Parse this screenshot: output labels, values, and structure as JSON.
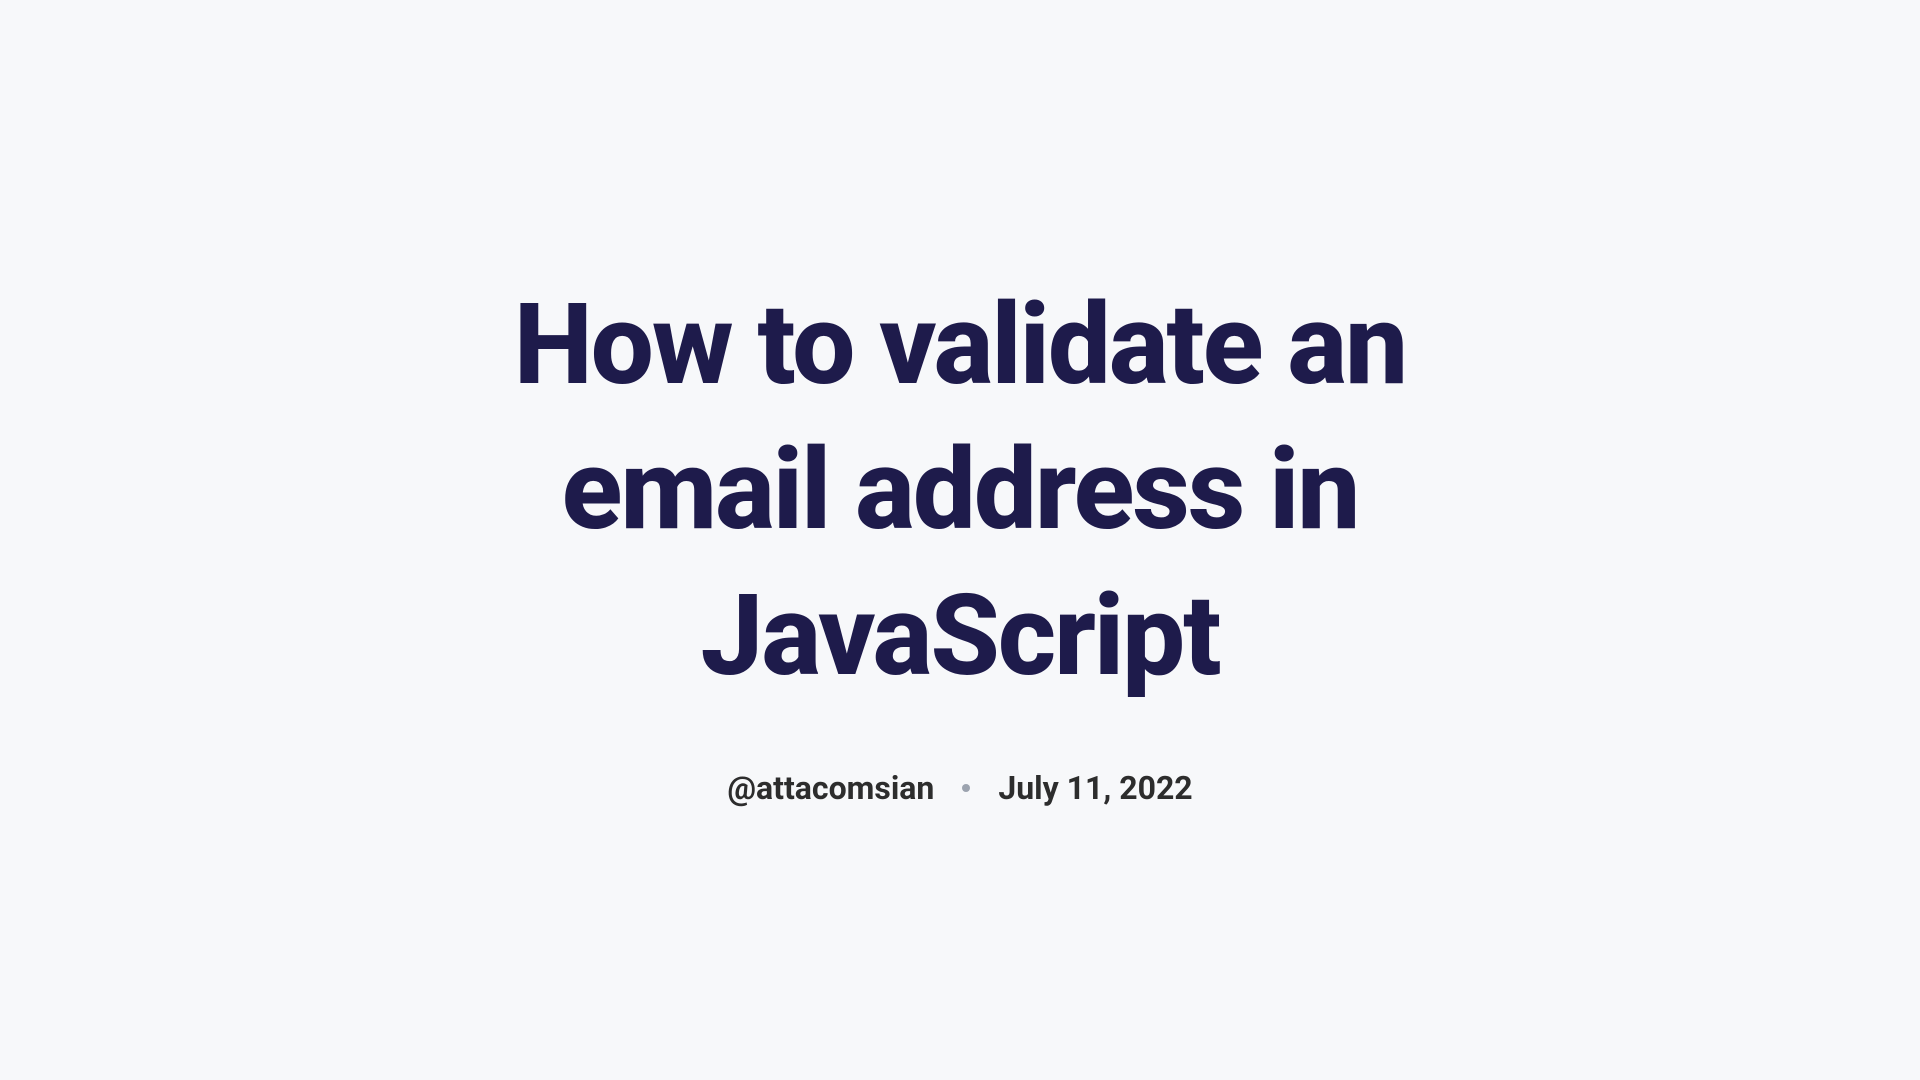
{
  "article": {
    "title": "How to validate an email address in JavaScript",
    "author": "@attacomsian",
    "date": "July 11, 2022"
  }
}
